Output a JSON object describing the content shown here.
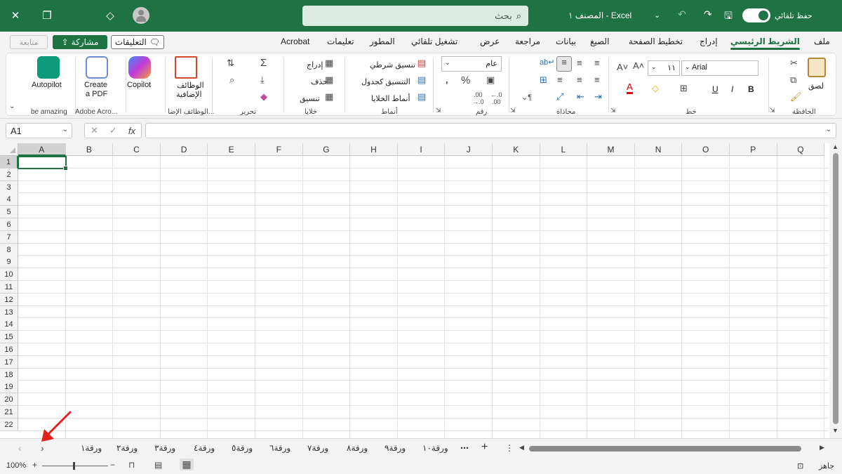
{
  "titlebar": {
    "search_placeholder": "بحث",
    "workbook_title": "المصنف ١  -  Excel",
    "autosave_label": "حفظ تلقائي"
  },
  "menu": {
    "follow_label": "متابعة",
    "share_label": "مشاركة",
    "comments_label": "التعليقات",
    "tabs": [
      "ملف",
      "الشريط الرئيسي",
      "إدراج",
      "تخطيط الصفحة",
      "الصيغ",
      "بيانات",
      "مراجعة",
      "عرض",
      "تشغيل تلقائي",
      "المطور",
      "تعليمات",
      "Acrobat"
    ],
    "active_tab": "الشريط الرئيسي"
  },
  "ribbon": {
    "groups": {
      "clipboard": "الحافظة",
      "font": "خط",
      "alignment": "محاذاة",
      "number": "رقم",
      "styles": "أنماط",
      "cells": "خلايا",
      "editing": "تحرير",
      "addins": "الوظائف الإضا...",
      "adobe": "Adobe Acro...",
      "beamazing": "be amazing"
    },
    "paste_label": "لصق",
    "font_name": "Arial",
    "font_size": "١١",
    "number_format": "عام",
    "conditional_format": "تنسيق شرطي",
    "format_as_table": "التنسيق كجدول",
    "cell_styles": "أنماط الخلايا",
    "insert": "إدراج",
    "delete": "حذف",
    "format": "تنسيق",
    "addins_label_1": "الوظائف",
    "addins_label_2": "الإضافية",
    "copilot": "Copilot",
    "create_pdf_1": "Create",
    "create_pdf_2": "a PDF",
    "autopilot": "Autopilot",
    "bold": "B",
    "italic": "I",
    "underline": "U"
  },
  "formula_bar": {
    "name_box": "A1",
    "fx": "fx",
    "formula": ""
  },
  "grid": {
    "columns": [
      "A",
      "B",
      "C",
      "D",
      "E",
      "F",
      "G",
      "H",
      "I",
      "J",
      "K",
      "L",
      "M",
      "N",
      "O",
      "P",
      "Q"
    ],
    "rows": [
      "1",
      "2",
      "3",
      "4",
      "5",
      "6",
      "7",
      "8",
      "9",
      "10",
      "11",
      "12",
      "13",
      "14",
      "15",
      "16",
      "17",
      "18",
      "19",
      "20",
      "21",
      "22"
    ],
    "selected_cell": "A1"
  },
  "sheets": {
    "tabs": [
      "ورقة١",
      "ورقة٢",
      "ورقة٣",
      "ورقة٤",
      "ورقة٥",
      "ورقة٦",
      "ورقة٧",
      "ورقة٨",
      "ورقة٩",
      "ورقة١٠"
    ],
    "more": "⋯",
    "add": "+"
  },
  "status": {
    "ready": "جاهز",
    "zoom": "100%",
    "accent_color": "#1f7244",
    "arrow_color": "#e0201a"
  }
}
